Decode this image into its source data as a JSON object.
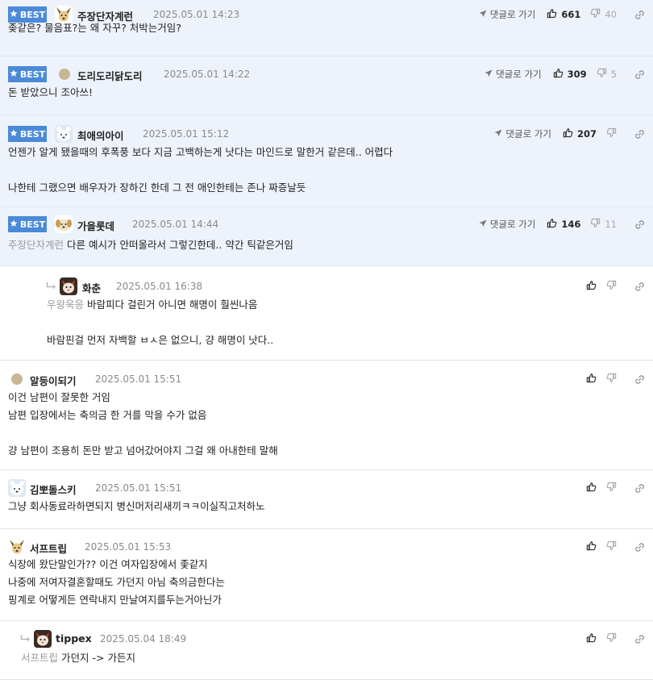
{
  "labels": {
    "best": "BEST",
    "goto_reply": "댓글로 가기"
  },
  "colors": {
    "best_badge": "#4a8ad9",
    "best_bg": "#eef3fb",
    "mention": "#9a9a9a"
  },
  "comments": [
    {
      "id": "c1",
      "best": true,
      "avatar": "dog-icon",
      "nick": "주장단자계런",
      "date": "2025.05.01 14:23",
      "likes": "661",
      "dislikes": "40",
      "mention": "",
      "lines": [
        "좆같은? 물음표?는 왜 자꾸? 처박는거임?"
      ]
    },
    {
      "id": "c2",
      "best": true,
      "avatar": "dot-icon",
      "nick": "도리도리닭도리",
      "date": "2025.05.01 14:22",
      "likes": "309",
      "dislikes": "5",
      "mention": "",
      "lines": [
        "돈 받았으니 조아쓰!"
      ]
    },
    {
      "id": "c3",
      "best": true,
      "avatar": "bear-icon",
      "nick": "최애의아이",
      "date": "2025.05.01 15:12",
      "likes": "207",
      "dislikes": "",
      "mention": "",
      "lines": [
        "언젠가 알게 됐을때의 후폭풍 보다 지금 고백하는게 낫다는 마인드로 말한거 같은데.. 어렵다",
        "",
        "나한테 그랬으면 배우자가 장하긴 한데 그 전 애인한테는 존나 짜증날듯"
      ]
    },
    {
      "id": "c4",
      "best": true,
      "avatar": "puppy-icon",
      "nick": "가을롯데",
      "date": "2025.05.01 14:44",
      "likes": "146",
      "dislikes": "11",
      "mention": "주장단자계런",
      "lines": [
        "다른 예시가 안떠올라서 그렇긴한데.. 약간 틱같은거임"
      ]
    },
    {
      "id": "c5",
      "best": false,
      "reply": true,
      "avatar": "fox-icon",
      "nick": "화춘",
      "date": "2025.05.01 16:38",
      "likes": "",
      "dislikes": "",
      "mention": "우왕욱응",
      "lines": [
        "바람피다 걸린거 아니면 해명이 훨씬나음",
        "",
        "바람핀걸 먼저 자백할 ㅂㅅ은 없으니, 걍 해명이 낫다.."
      ]
    },
    {
      "id": "c6",
      "best": false,
      "avatar": "dot-icon",
      "nick": "알등이되기",
      "date": "2025.05.01 15:51",
      "likes": "",
      "dislikes": "",
      "mention": "",
      "lines": [
        "이건 남편이 잘못한 거임",
        "남편 입장에서는 축의금 한 거를 막을 수가 없음",
        "",
        "걍 남편이 조용히 돈만 받고 넘어갔어야지 그걸 왜 아내한테 말해"
      ]
    },
    {
      "id": "c7",
      "best": false,
      "avatar": "bear-icon",
      "nick": "김뽀돌스키",
      "date": "2025.05.01 15:51",
      "likes": "",
      "dislikes": "",
      "mention": "",
      "lines": [
        "그냥 회사동료라하면되지 병신머저리새끼ㅋㅋ이실직고처하노"
      ]
    },
    {
      "id": "c8",
      "best": false,
      "avatar": "dog-icon",
      "nick": "서프트립",
      "date": "2025.05.01 15:53",
      "likes": "",
      "dislikes": "",
      "mention": "",
      "lines": [
        "식장에 왔단말인가?? 이건 여자입장에서 좇같지",
        "나중에 저여자결혼할때도 가던지 아님 축의금한다는",
        "핑계로 어떻게든 연락내지 만날여지를두는거아닌가"
      ]
    },
    {
      "id": "c9",
      "best": false,
      "reply": true,
      "avatar": "fox-icon",
      "nick": "tippex",
      "date": "2025.05.04 18:49",
      "likes": "",
      "dislikes": "",
      "mention": "서프트립",
      "lines": [
        "가던지 -> 가든지"
      ]
    }
  ]
}
